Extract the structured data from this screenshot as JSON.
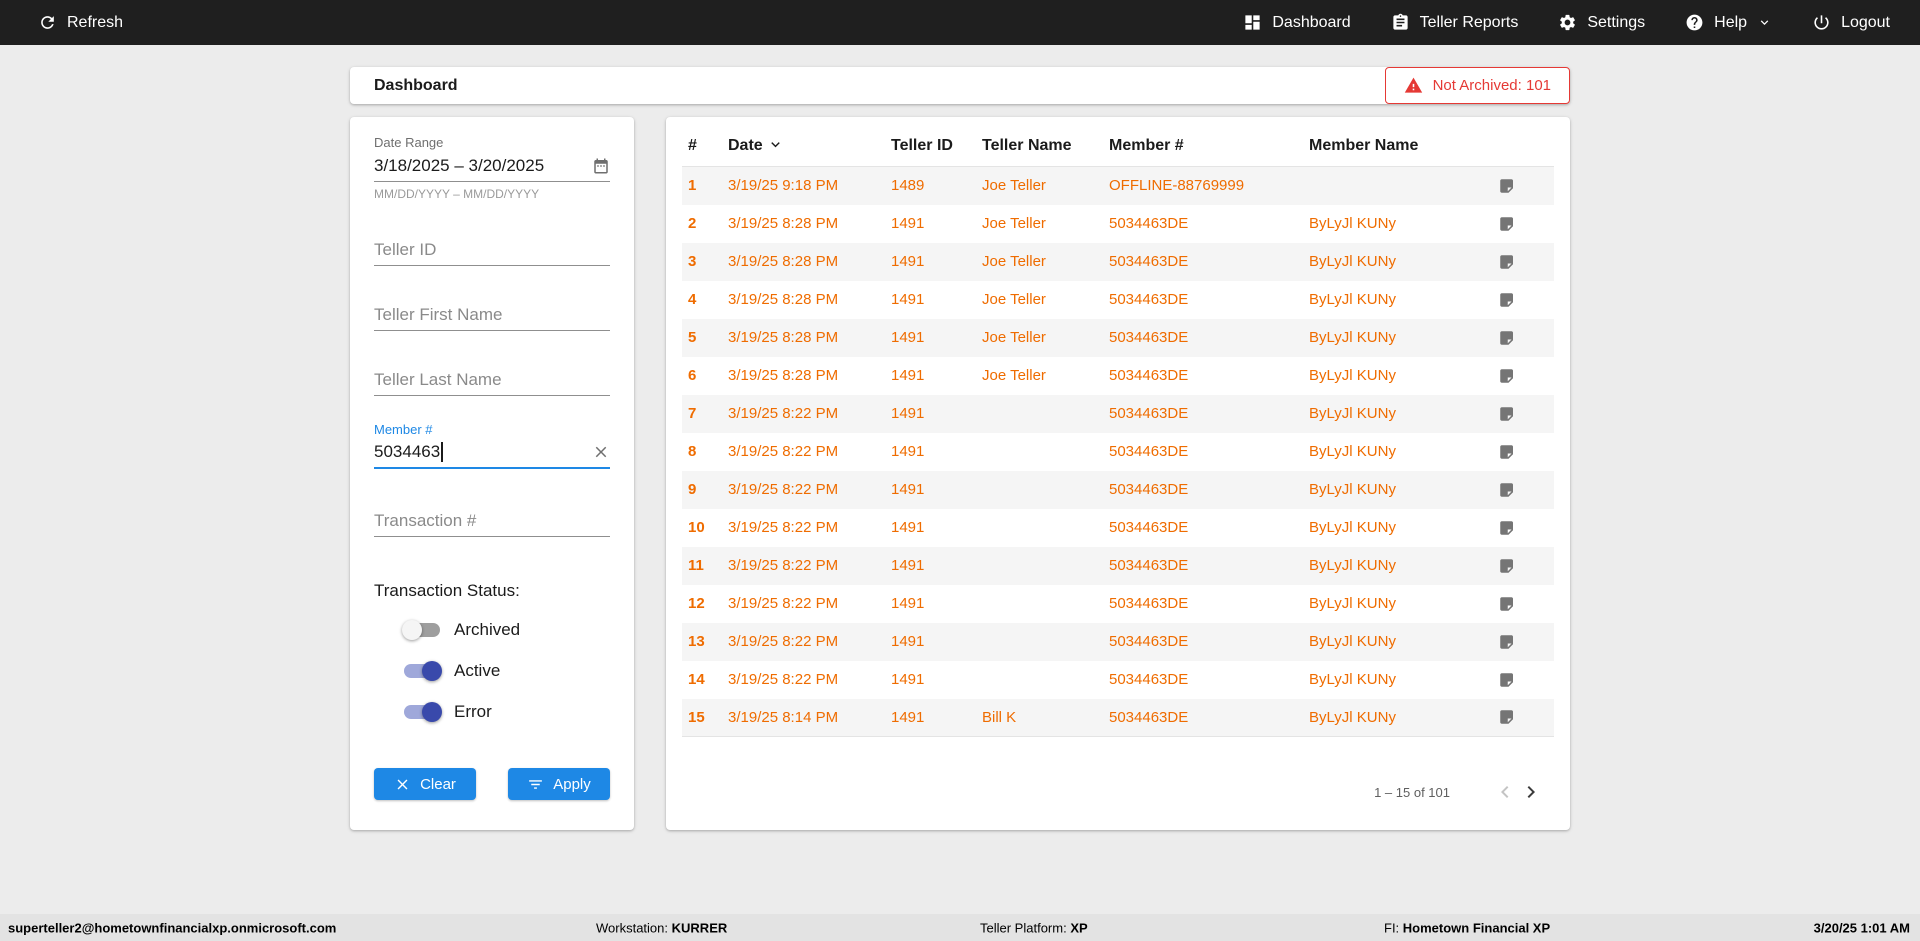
{
  "topbar": {
    "refresh_label": "Refresh",
    "nav": [
      {
        "label": "Dashboard"
      },
      {
        "label": "Teller Reports"
      },
      {
        "label": "Settings"
      },
      {
        "label": "Help"
      },
      {
        "label": "Logout"
      }
    ]
  },
  "header": {
    "title": "Dashboard",
    "not_archived_label": "Not Archived: 101"
  },
  "filters": {
    "date_range": {
      "label": "Date Range",
      "value": "3/18/2025 – 3/20/2025",
      "helper": "MM/DD/YYYY – MM/DD/YYYY"
    },
    "teller_id_placeholder": "Teller ID",
    "teller_first_name_placeholder": "Teller First Name",
    "teller_last_name_placeholder": "Teller Last Name",
    "member_number": {
      "label": "Member #",
      "value": "5034463"
    },
    "transaction_number_placeholder": "Transaction #",
    "transaction_status": {
      "label": "Transaction Status:",
      "toggles": [
        {
          "label": "Archived",
          "on": false
        },
        {
          "label": "Active",
          "on": true
        },
        {
          "label": "Error",
          "on": true
        }
      ]
    },
    "clear_label": "Clear",
    "apply_label": "Apply"
  },
  "table": {
    "columns": [
      "#",
      "Date",
      "Teller ID",
      "Teller Name",
      "Member #",
      "Member Name"
    ],
    "rows": [
      {
        "num": "1",
        "date": "3/19/25 9:18 PM",
        "teller_id": "1489",
        "teller_name": "Joe Teller",
        "member_number": "OFFLINE-88769999",
        "member_name": ""
      },
      {
        "num": "2",
        "date": "3/19/25 8:28 PM",
        "teller_id": "1491",
        "teller_name": "Joe Teller",
        "member_number": "5034463DE",
        "member_name": "ByLyJl KUNy"
      },
      {
        "num": "3",
        "date": "3/19/25 8:28 PM",
        "teller_id": "1491",
        "teller_name": "Joe Teller",
        "member_number": "5034463DE",
        "member_name": "ByLyJl KUNy"
      },
      {
        "num": "4",
        "date": "3/19/25 8:28 PM",
        "teller_id": "1491",
        "teller_name": "Joe Teller",
        "member_number": "5034463DE",
        "member_name": "ByLyJl KUNy"
      },
      {
        "num": "5",
        "date": "3/19/25 8:28 PM",
        "teller_id": "1491",
        "teller_name": "Joe Teller",
        "member_number": "5034463DE",
        "member_name": "ByLyJl KUNy"
      },
      {
        "num": "6",
        "date": "3/19/25 8:28 PM",
        "teller_id": "1491",
        "teller_name": "Joe Teller",
        "member_number": "5034463DE",
        "member_name": "ByLyJl KUNy"
      },
      {
        "num": "7",
        "date": "3/19/25 8:22 PM",
        "teller_id": "1491",
        "teller_name": "",
        "member_number": "5034463DE",
        "member_name": "ByLyJl KUNy"
      },
      {
        "num": "8",
        "date": "3/19/25 8:22 PM",
        "teller_id": "1491",
        "teller_name": "",
        "member_number": "5034463DE",
        "member_name": "ByLyJl KUNy"
      },
      {
        "num": "9",
        "date": "3/19/25 8:22 PM",
        "teller_id": "1491",
        "teller_name": "",
        "member_number": "5034463DE",
        "member_name": "ByLyJl KUNy"
      },
      {
        "num": "10",
        "date": "3/19/25 8:22 PM",
        "teller_id": "1491",
        "teller_name": "",
        "member_number": "5034463DE",
        "member_name": "ByLyJl KUNy"
      },
      {
        "num": "11",
        "date": "3/19/25 8:22 PM",
        "teller_id": "1491",
        "teller_name": "",
        "member_number": "5034463DE",
        "member_name": "ByLyJl KUNy"
      },
      {
        "num": "12",
        "date": "3/19/25 8:22 PM",
        "teller_id": "1491",
        "teller_name": "",
        "member_number": "5034463DE",
        "member_name": "ByLyJl KUNy"
      },
      {
        "num": "13",
        "date": "3/19/25 8:22 PM",
        "teller_id": "1491",
        "teller_name": "",
        "member_number": "5034463DE",
        "member_name": "ByLyJl KUNy"
      },
      {
        "num": "14",
        "date": "3/19/25 8:22 PM",
        "teller_id": "1491",
        "teller_name": "",
        "member_number": "5034463DE",
        "member_name": "ByLyJl KUNy"
      },
      {
        "num": "15",
        "date": "3/19/25 8:14 PM",
        "teller_id": "1491",
        "teller_name": "Bill K",
        "member_number": "5034463DE",
        "member_name": "ByLyJl KUNy"
      }
    ],
    "pagination": {
      "range_label": "1 – 15 of 101"
    }
  },
  "statusbar": {
    "user": "superteller2@hometownfinancialxp.onmicrosoft.com",
    "workstation_label": "Workstation:",
    "workstation_value": "KURRER",
    "platform_label": "Teller Platform:",
    "platform_value": "XP",
    "fi_label": "FI:",
    "fi_value": "Hometown Financial XP",
    "datetime": "3/20/25 1:01 AM"
  },
  "colors": {
    "topbar_bg": "#1f1f1f",
    "accent_blue": "#1e88e5",
    "toggle_on_blue": "#3949ab",
    "row_text_orange": "#ef6c00",
    "alert_red": "#e53935"
  }
}
